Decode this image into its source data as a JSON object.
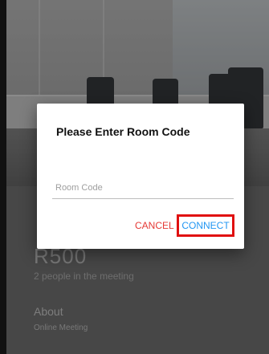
{
  "dialog": {
    "title": "Please Enter Room Code",
    "input_placeholder": "Room Code",
    "input_value": "",
    "cancel_label": "CANCEL",
    "connect_label": "CONNECT"
  },
  "room": {
    "name": "R500",
    "participants": "2 people in the meeting",
    "about_heading": "About",
    "about_text": "Online Meeting"
  },
  "colors": {
    "cancel": "#e53935",
    "connect": "#2196f3",
    "highlight": "#e01010"
  }
}
